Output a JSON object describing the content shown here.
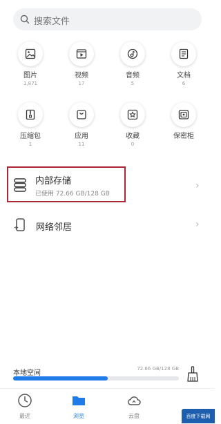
{
  "search": {
    "placeholder": "搜索文件"
  },
  "categories": [
    {
      "label": "图片",
      "count": "1,871",
      "icon": "image-icon"
    },
    {
      "label": "视频",
      "count": "17",
      "icon": "video-icon"
    },
    {
      "label": "音频",
      "count": "5",
      "icon": "music-icon"
    },
    {
      "label": "文档",
      "count": "6",
      "icon": "document-icon"
    },
    {
      "label": "压缩包",
      "count": "1",
      "icon": "archive-icon"
    },
    {
      "label": "应用",
      "count": "11",
      "icon": "app-bag-icon"
    },
    {
      "label": "收藏",
      "count": "0",
      "icon": "star-icon"
    },
    {
      "label": "保密柜",
      "count": "",
      "icon": "safe-icon"
    }
  ],
  "storage": {
    "title": "内部存储",
    "used_text": "已使用 72.66 GB/128 GB",
    "icon": "storage-stack-icon"
  },
  "network": {
    "title": "网络邻居",
    "icon": "network-device-icon"
  },
  "local_space": {
    "label": "本地空间",
    "detail": "72.66 GB/128 GB",
    "used_fraction": 0.57
  },
  "tabs": [
    {
      "label": "最近",
      "icon": "clock-icon",
      "active": false
    },
    {
      "label": "浏览",
      "icon": "folder-icon",
      "active": true
    },
    {
      "label": "云盘",
      "icon": "cloud-icon",
      "active": false
    }
  ],
  "watermark": {
    "text": "百度下载网"
  },
  "colors": {
    "accent": "#1e7be8",
    "highlight_border": "#a82834"
  }
}
